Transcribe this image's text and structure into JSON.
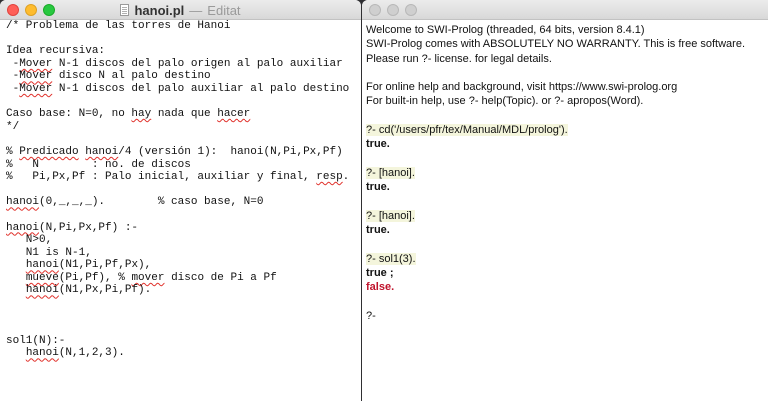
{
  "editor": {
    "title": "hanoi.pl",
    "separator": "—",
    "status": "Editat",
    "lines": [
      "/* Problema de las torres de Hanoi",
      "",
      "Idea recursiva:",
      " -Mover N-1 discos del palo origen al palo auxiliar",
      " -Mover disco N al palo destino",
      " -Mover N-1 discos del palo auxiliar al palo destino",
      "",
      "Caso base: N=0, no hay nada que hacer",
      "*/",
      "",
      "% Predicado hanoi/4 (versión 1):  hanoi(N,Pi,Px,Pf)",
      "%   N        : no. de discos",
      "%   Pi,Px,Pf : Palo inicial, auxiliar y final, resp.",
      "",
      "hanoi(0,_,_,_).        % caso base, N=0",
      "",
      "hanoi(N,Pi,Px,Pf) :-",
      "   N>0,",
      "   N1 is N-1,",
      "   hanoi(N1,Pi,Pf,Px),",
      "   mueve(Pi,Pf), % mover disco de Pi a Pf",
      "   hanoi(N1,Px,Pi,Pf).",
      "",
      "",
      "",
      "sol1(N):-",
      "   hanoi(N,1,2,3)."
    ]
  },
  "console": {
    "lines": [
      {
        "text": "Welcome to SWI-Prolog (threaded, 64 bits, version 8.4.1)",
        "style": "normal"
      },
      {
        "text": "SWI-Prolog comes with ABSOLUTELY NO WARRANTY. This is free software.",
        "style": "normal"
      },
      {
        "text": "Please run ?- license. for legal details.",
        "style": "normal"
      },
      {
        "text": "",
        "style": "normal"
      },
      {
        "text": "For online help and background, visit https://www.swi-prolog.org",
        "style": "normal"
      },
      {
        "text": "For built-in help, use ?- help(Topic). or ?- apropos(Word).",
        "style": "normal"
      },
      {
        "text": "",
        "style": "normal"
      },
      {
        "text": "?- cd('/users/pfr/tex/Manual/MDL/prolog').",
        "style": "query"
      },
      {
        "text": "true.",
        "style": "bold"
      },
      {
        "text": "",
        "style": "normal"
      },
      {
        "text": "?- [hanoi].",
        "style": "query"
      },
      {
        "text": "true.",
        "style": "bold"
      },
      {
        "text": "",
        "style": "normal"
      },
      {
        "text": "?- [hanoi].",
        "style": "query"
      },
      {
        "text": "true.",
        "style": "bold"
      },
      {
        "text": "",
        "style": "normal"
      },
      {
        "text": "?- sol1(3).",
        "style": "query"
      },
      {
        "text": "true ;",
        "style": "bold"
      },
      {
        "text": "false.",
        "style": "false"
      },
      {
        "text": "",
        "style": "normal"
      },
      {
        "text": "?- ",
        "style": "normal"
      }
    ]
  },
  "colors": {
    "query_background": "#f4f5dc",
    "false_text": "#c0132c",
    "spellcheck_underline": "#e0302a"
  }
}
